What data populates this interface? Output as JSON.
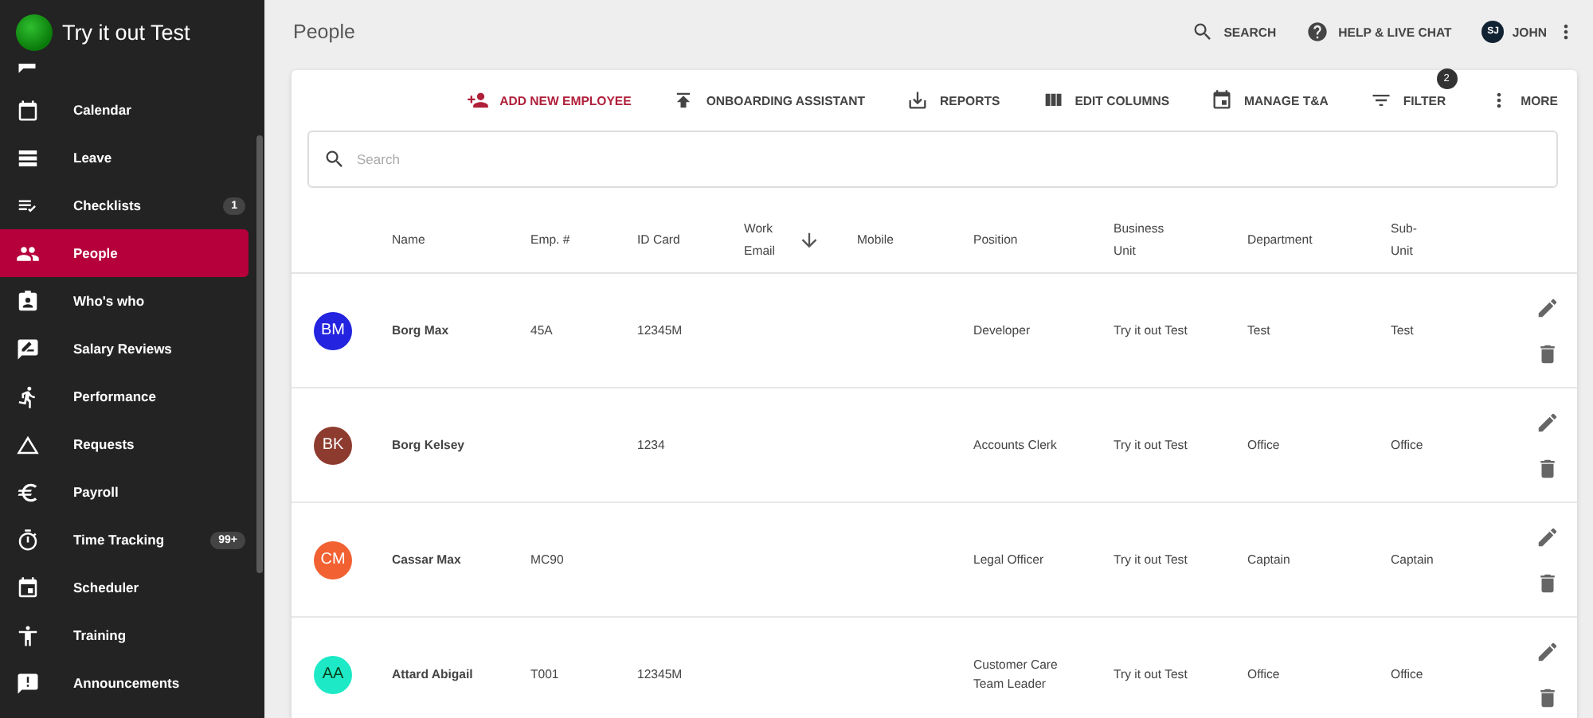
{
  "app": {
    "title": "Try it out Test"
  },
  "sidebar": {
    "items": [
      {
        "label": "Calendar",
        "selected": false
      },
      {
        "label": "Leave",
        "selected": false
      },
      {
        "label": "Checklists",
        "selected": false,
        "badge": "1"
      },
      {
        "label": "People",
        "selected": true
      },
      {
        "label": "Who's who",
        "selected": false
      },
      {
        "label": "Salary Reviews",
        "selected": false
      },
      {
        "label": "Performance",
        "selected": false
      },
      {
        "label": "Requests",
        "selected": false
      },
      {
        "label": "Payroll",
        "selected": false
      },
      {
        "label": "Time Tracking",
        "selected": false,
        "badge": "99+"
      },
      {
        "label": "Scheduler",
        "selected": false
      },
      {
        "label": "Training",
        "selected": false
      },
      {
        "label": "Announcements",
        "selected": false
      }
    ]
  },
  "header": {
    "title": "People",
    "search": "SEARCH",
    "help": "HELP & LIVE CHAT",
    "user_initials": "SJ",
    "user_name": "JOHN"
  },
  "toolbar": [
    {
      "label": "ADD NEW EMPLOYEE",
      "kind": "primary"
    },
    {
      "label": "ONBOARDING ASSISTANT",
      "kind": "normal"
    },
    {
      "label": "REPORTS",
      "kind": "normal"
    },
    {
      "label": "EDIT COLUMNS",
      "kind": "normal"
    },
    {
      "label": "MANAGE T&A",
      "kind": "normal"
    },
    {
      "label": "FILTER",
      "kind": "normal",
      "badge": "2"
    },
    {
      "label": "MORE",
      "kind": "normal"
    }
  ],
  "search": {
    "placeholder": "Search"
  },
  "table": {
    "columns": [
      {
        "label": "Name",
        "sorted": false
      },
      {
        "label": "Emp. #",
        "sorted": false
      },
      {
        "label": "ID Card",
        "sorted": false
      },
      {
        "label": "Work Email",
        "sorted": true
      },
      {
        "label": "Mobile",
        "sorted": false
      },
      {
        "label": "Position",
        "sorted": false
      },
      {
        "label": "Business Unit",
        "sorted": false
      },
      {
        "label": "Department",
        "sorted": false
      },
      {
        "label": "Sub-Unit",
        "sorted": false
      }
    ],
    "rows": [
      {
        "initials": "BM",
        "color": "#2323e0",
        "cells": [
          "Borg Max",
          "45A",
          "12345M",
          "",
          "",
          "Developer",
          "Try it out Test",
          "Test",
          "Test"
        ]
      },
      {
        "initials": "BK",
        "color": "#8e3b2f",
        "cells": [
          "Borg Kelsey",
          "",
          "1234",
          "",
          "",
          "Accounts Clerk",
          "Try it out Test",
          "Office",
          "Office"
        ]
      },
      {
        "initials": "CM",
        "color": "#f26132",
        "cells": [
          "Cassar Max",
          "MC90",
          "",
          "",
          "",
          "Legal Officer",
          "Try it out Test",
          "Captain",
          "Captain"
        ]
      },
      {
        "initials": "AA",
        "color": "#1de9c6",
        "cells": [
          "Attard Abigail",
          "T001",
          "12345M",
          "",
          "",
          "Customer Care Team Leader",
          "Try it out Test",
          "Office",
          "Office"
        ]
      }
    ]
  }
}
